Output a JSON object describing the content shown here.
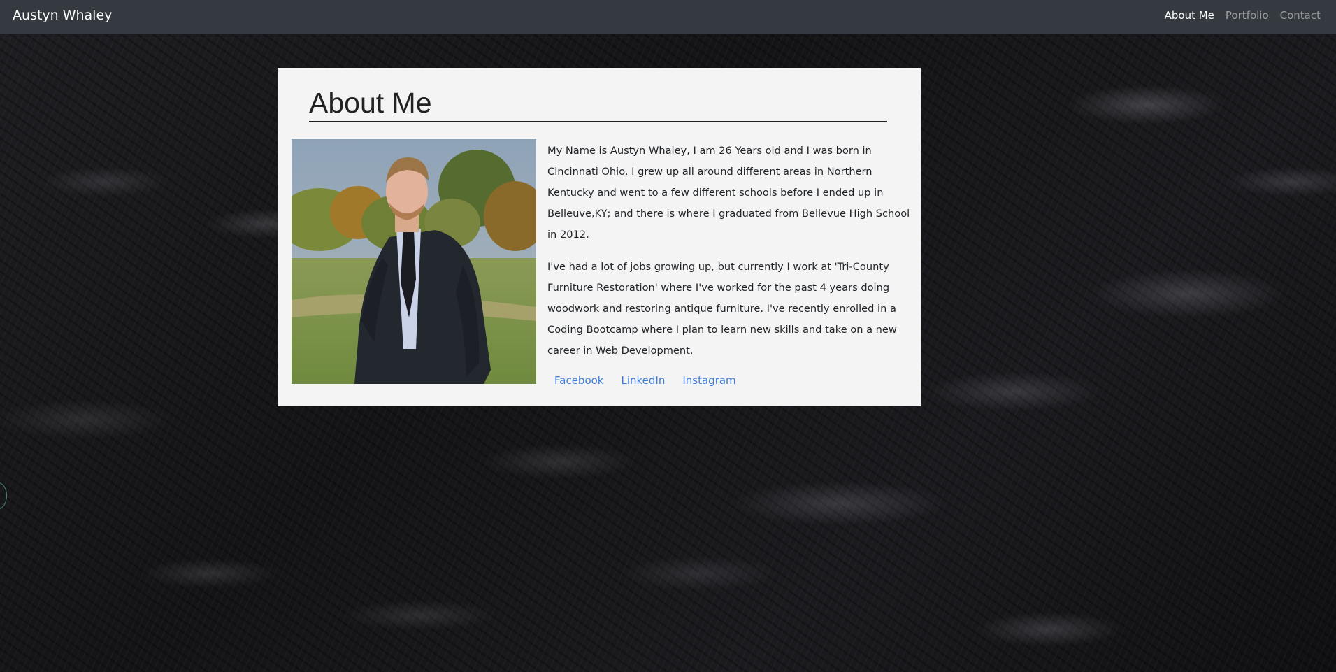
{
  "navbar": {
    "brand": "Austyn Whaley",
    "links": [
      {
        "label": "About Me",
        "active": true
      },
      {
        "label": "Portfolio",
        "active": false
      },
      {
        "label": "Contact",
        "active": false
      }
    ]
  },
  "about": {
    "title": "About Me",
    "paragraphs": [
      "My Name is Austyn Whaley, I am 26 Years old and I was born in Cincinnati Ohio. I grew up all around different areas in Northern Kentucky and went to a few different schools before I ended up in Belleuve,KY; and there is where I graduated from Bellevue High School in 2012.",
      "I've had a lot of jobs growing up, but currently I work at 'Tri-County Furniture Restoration' where I've worked for the past 4 years doing woodwork and restoring antique furniture. I've recently enrolled in a Coding Bootcamp where I plan to learn new skills and take on a new career in Web Development."
    ],
    "social_links": [
      "Facebook",
      "LinkedIn",
      "Instagram"
    ]
  },
  "colors": {
    "navbar_bg": "#343a40",
    "card_bg": "#f4f4f4",
    "link": "#3d7bd9"
  }
}
